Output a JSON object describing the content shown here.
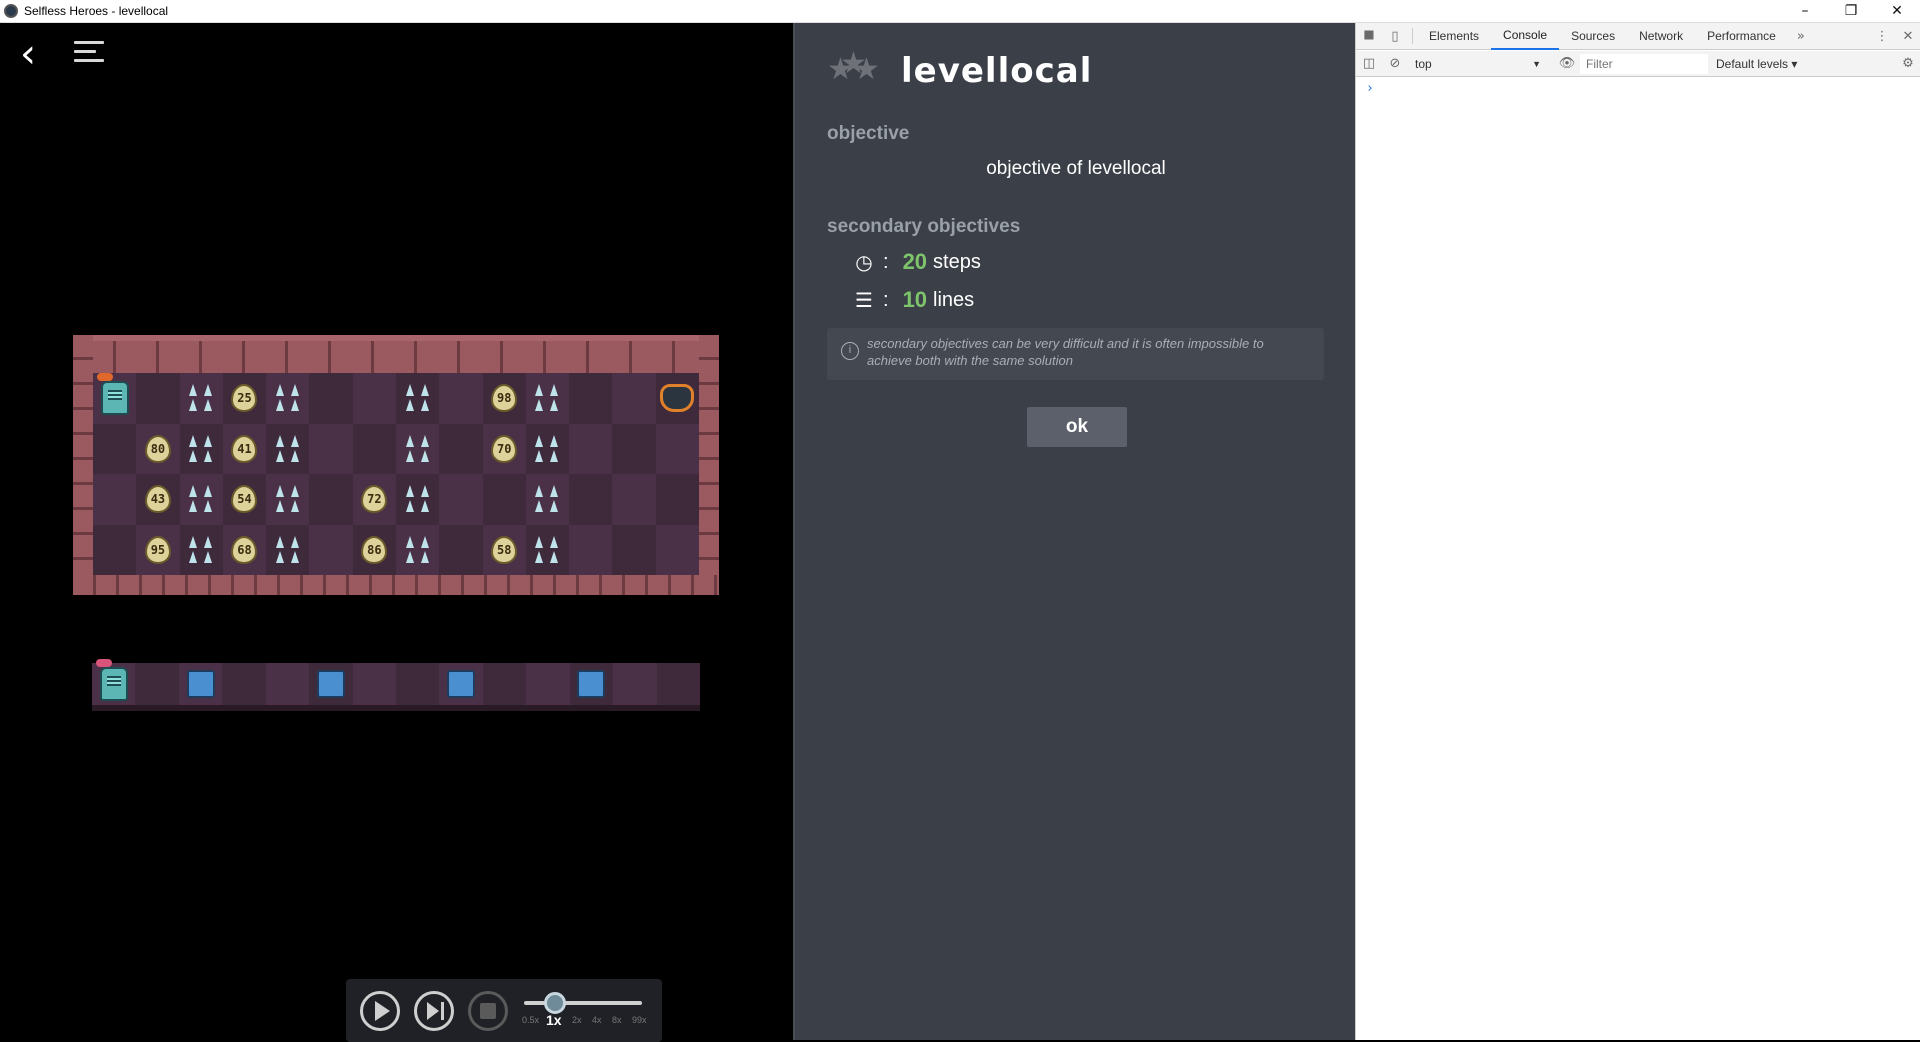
{
  "window": {
    "title": "Selfless Heroes - levellocal",
    "minimize": "–",
    "restore": "❐",
    "close": "✕"
  },
  "game": {
    "back_icon": "chevron-left-icon",
    "menu_icon": "menu-collapse-icon",
    "board": {
      "rows": [
        [
          "hero",
          "",
          "spikes",
          "egg:25",
          "spikes",
          "",
          "",
          "spikes",
          "",
          "egg:98",
          "spikes",
          "",
          "",
          "cauldron"
        ],
        [
          "",
          "egg:80",
          "spikes",
          "egg:41",
          "spikes",
          "",
          "",
          "spikes",
          "",
          "egg:70",
          "spikes",
          "",
          "",
          ""
        ],
        [
          "",
          "egg:43",
          "spikes",
          "egg:54",
          "spikes",
          "",
          "egg:72",
          "spikes",
          "",
          "",
          "spikes",
          "",
          "",
          ""
        ],
        [
          "",
          "egg:95",
          "spikes",
          "egg:68",
          "spikes",
          "",
          "egg:86",
          "spikes",
          "",
          "egg:58",
          "spikes",
          "",
          "",
          ""
        ]
      ]
    },
    "memory_row": [
      "hero",
      "",
      "block",
      "",
      "",
      "block",
      "",
      "",
      "block",
      "",
      "",
      "block",
      "",
      ""
    ],
    "controls": {
      "speeds": [
        "0.5x",
        "1x",
        "2x",
        "4x",
        "8x",
        "99x"
      ],
      "active_speed": "1x"
    }
  },
  "panel": {
    "stars_earned": 0,
    "stars_total": 3,
    "level_title": "levellocal",
    "objective_heading": "objective",
    "objective_text": "objective of levellocal",
    "secondary_heading": "secondary objectives",
    "steps_value": "20",
    "steps_label": "steps",
    "lines_value": "10",
    "lines_label": "lines",
    "note": "secondary objectives can be very difficult and it is often impossible to achieve both with the same solution",
    "ok_label": "ok",
    "colors": {
      "accent_green": "#7ec46a",
      "panel_bg": "#3b3f47"
    }
  },
  "devtools": {
    "tabs": [
      "Elements",
      "Console",
      "Sources",
      "Network",
      "Performance"
    ],
    "active_tab": "Console",
    "more_tabs": "»",
    "context": "top",
    "filter_placeholder": "Filter",
    "levels_label": "Default levels ▾",
    "prompt": "›"
  }
}
